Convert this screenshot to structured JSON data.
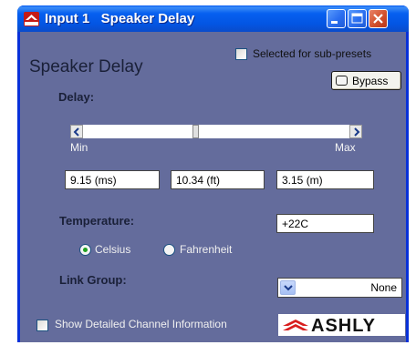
{
  "window": {
    "title": "Input 1   Speaker Delay",
    "app_icon": "ashly-icon",
    "title_icon_text": "ASHLY"
  },
  "panel": {
    "title": "Speaker Delay",
    "subpreset_label": "Selected for sub-presets",
    "subpreset_checked": false,
    "bypass_label": "Bypass"
  },
  "delay": {
    "label": "Delay:",
    "scale_min": "Min",
    "scale_max": "Max",
    "slider_position": 0.42,
    "ms_value": "9.15 (ms)",
    "ft_value": "10.34 (ft)",
    "m_value": "3.15 (m)"
  },
  "temperature": {
    "label": "Temperature:",
    "value": "+22C",
    "unit_celsius": "Celsius",
    "unit_fahrenheit": "Fahrenheit",
    "selected_unit": "Celsius"
  },
  "link_group": {
    "label": "Link Group:",
    "value": "None"
  },
  "footer": {
    "detail_label": "Show Detailed Channel Information",
    "detail_checked": false,
    "logo_text": "ASHLY"
  },
  "colors": {
    "titlebar": "#0355e3",
    "panel_bg": "#646c9c",
    "close_button": "#d3512c",
    "logo_red": "#d81e1e"
  }
}
